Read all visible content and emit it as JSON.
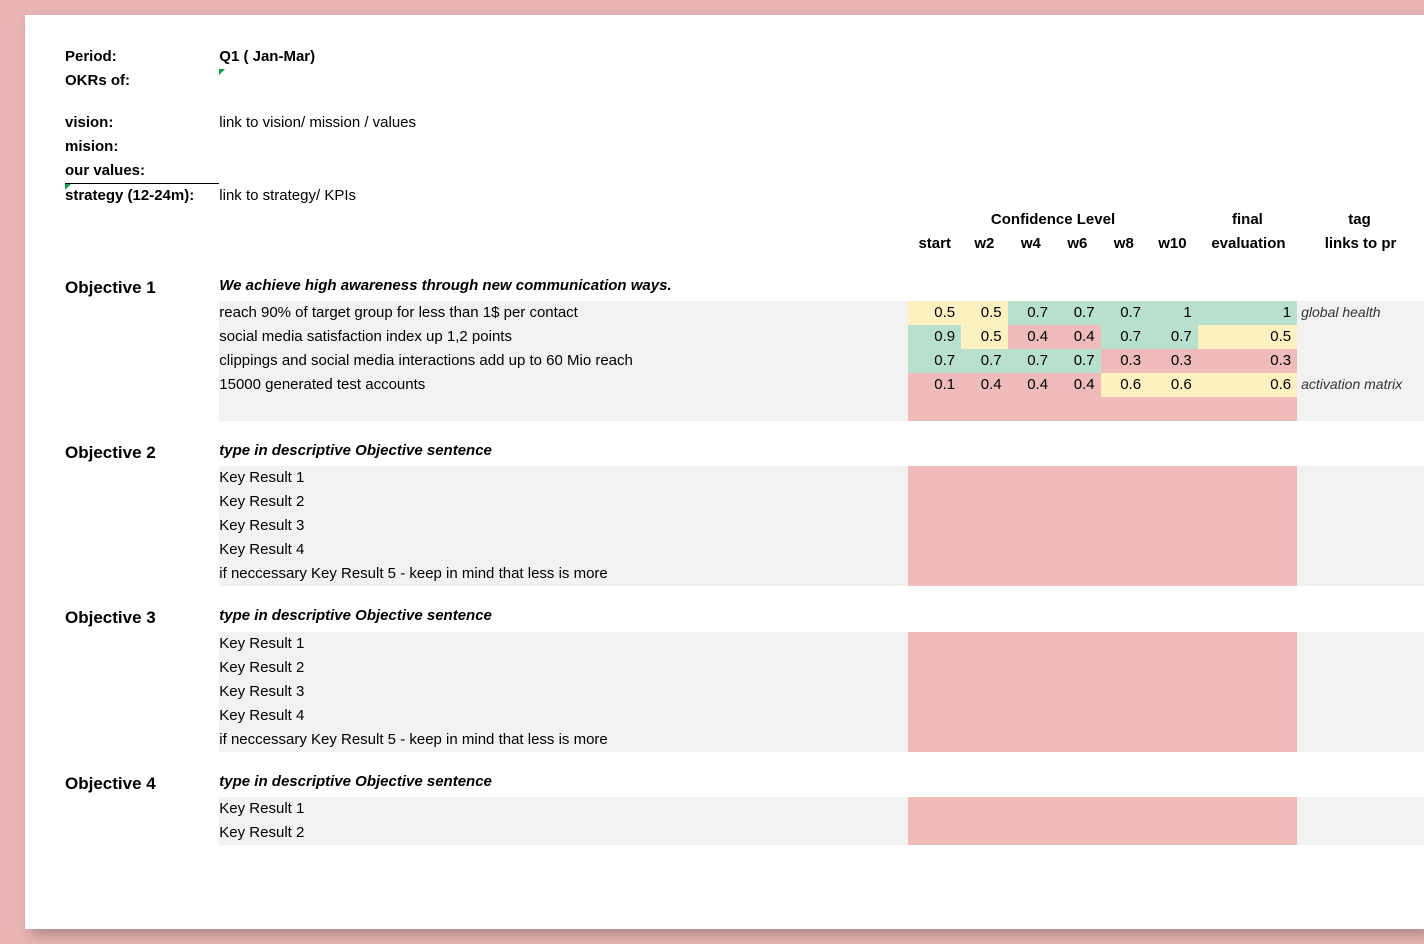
{
  "meta": {
    "period_label": "Period:",
    "period_value": "Q1 ( Jan-Mar)",
    "okrs_of_label": "OKRs of:",
    "vision_label": "vision:",
    "vision_value": "link to vision/ mission / values",
    "mision_label": "mision:",
    "our_values_label": "our values:",
    "strategy_label": "strategy (12-24m):",
    "strategy_value": "link to strategy/ KPIs"
  },
  "headers": {
    "confidence": "Confidence Level",
    "start": "start",
    "w2": "w2",
    "w4": "w4",
    "w6": "w6",
    "w8": "w8",
    "w10": "w10",
    "final1": "final",
    "final2": "evaluation",
    "tag1": "tag",
    "tag2": "links to pr"
  },
  "obj1": {
    "label": "Objective 1",
    "title": "We achieve high awareness through new communication ways.",
    "kr1": {
      "desc": "reach 90% of target group for less than 1$ per contact",
      "start": "0.5",
      "w2": "0.5",
      "w4": "0.7",
      "w6": "0.7",
      "w8": "0.7",
      "w10": "1",
      "final": "1",
      "tag": "global health"
    },
    "kr2": {
      "desc": "social media satisfaction index up 1,2 points",
      "start": "0.9",
      "w2": "0.5",
      "w4": "0.4",
      "w6": "0.4",
      "w8": "0.7",
      "w10": "0.7",
      "final": "0.5",
      "tag": ""
    },
    "kr3": {
      "desc": "clippings and social media interactions add up to 60 Mio reach",
      "start": "0.7",
      "w2": "0.7",
      "w4": "0.7",
      "w6": "0.7",
      "w8": "0.3",
      "w10": "0.3",
      "final": "0.3",
      "tag": ""
    },
    "kr4": {
      "desc": "15000 generated test accounts",
      "start": "0.1",
      "w2": "0.4",
      "w4": "0.4",
      "w6": "0.4",
      "w8": "0.6",
      "w10": "0.6",
      "final": "0.6",
      "tag": "activation matrix"
    }
  },
  "obj2": {
    "label": "Objective 2",
    "title": "type in descriptive Objective sentence",
    "kr1": "Key Result 1",
    "kr2": "Key Result 2",
    "kr3": "Key Result 3",
    "kr4": "Key Result 4",
    "kr5": "if neccessary Key Result 5 - keep in mind that less is more"
  },
  "obj3": {
    "label": "Objective 3",
    "title": "type in descriptive Objective sentence",
    "kr1": "Key Result 1",
    "kr2": "Key Result 2",
    "kr3": "Key Result 3",
    "kr4": "Key Result 4",
    "kr5": "if neccessary Key Result 5 - keep in mind that less is more"
  },
  "obj4": {
    "label": "Objective 4",
    "title": "type in descriptive Objective sentence",
    "kr1": "Key Result 1",
    "kr2": "Key Result 2"
  }
}
